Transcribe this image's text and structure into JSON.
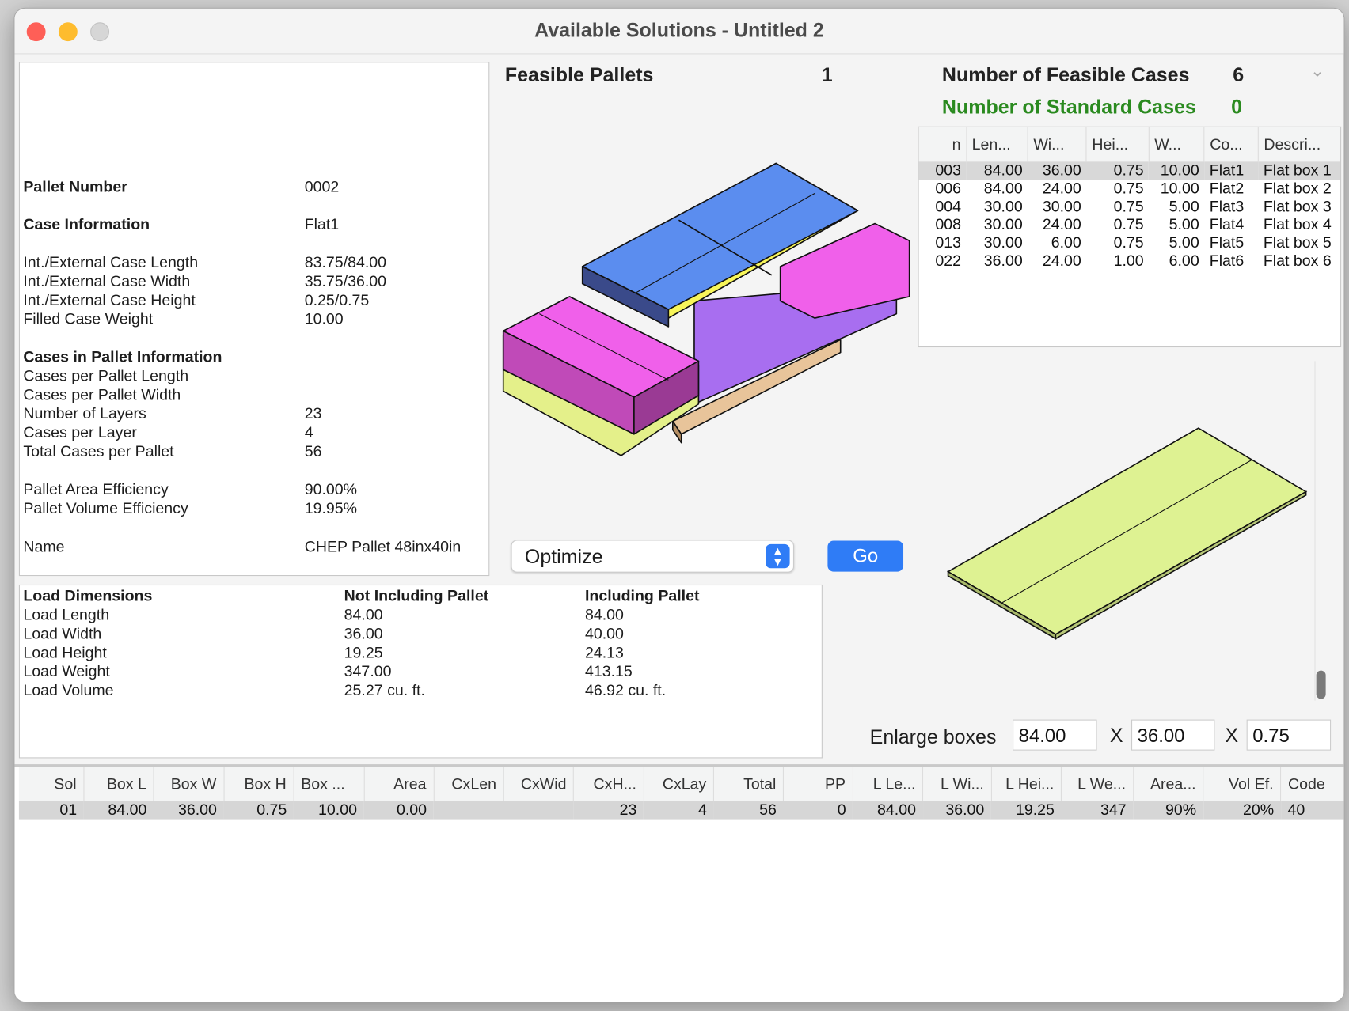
{
  "window": {
    "title": "Available Solutions - Untitled 2"
  },
  "info": {
    "rows": [
      {
        "label": "Pallet Number",
        "value": "0002",
        "bold": true
      },
      {
        "label": "Case Information",
        "value": "Flat1",
        "bold": true
      },
      {
        "label": "Int./External Case Length",
        "value": "83.75/84.00"
      },
      {
        "label": "Int./External Case Width",
        "value": "35.75/36.00"
      },
      {
        "label": "Int./External Case Height",
        "value": "0.25/0.75"
      },
      {
        "label": "Filled Case Weight",
        "value": "10.00"
      },
      {
        "label": "Cases in Pallet Information",
        "value": "",
        "bold": true
      },
      {
        "label": "Cases per Pallet Length",
        "value": ""
      },
      {
        "label": "Cases per Pallet Width",
        "value": ""
      },
      {
        "label": "Number of Layers",
        "value": "23"
      },
      {
        "label": "Cases per Layer",
        "value": "4"
      },
      {
        "label": "Total Cases per Pallet",
        "value": "56"
      },
      {
        "label": "Pallet Area Efficiency",
        "value": "90.00%"
      },
      {
        "label": "Pallet Volume Efficiency",
        "value": "19.95%"
      },
      {
        "label": "Name",
        "value": "CHEP Pallet 48inx40in"
      }
    ]
  },
  "summary": {
    "feasible_pallets_label": "Feasible Pallets",
    "feasible_pallets": "1",
    "feasible_cases_label": "Number of Feasible Cases",
    "feasible_cases": "6",
    "standard_cases_label": "Number of Standard Cases",
    "standard_cases": "0"
  },
  "cases_table": {
    "headers": [
      "n",
      "Len...",
      "Wi...",
      "Hei...",
      "W...",
      "Co...",
      "Descri..."
    ],
    "rows": [
      [
        "003",
        "84.00",
        "36.00",
        "0.75",
        "10.00",
        "Flat1",
        "Flat box 1"
      ],
      [
        "006",
        "84.00",
        "24.00",
        "0.75",
        "10.00",
        "Flat2",
        "Flat box 2"
      ],
      [
        "004",
        "30.00",
        "30.00",
        "0.75",
        "5.00",
        "Flat3",
        "Flat box 3"
      ],
      [
        "008",
        "30.00",
        "24.00",
        "0.75",
        "5.00",
        "Flat4",
        "Flat box 4"
      ],
      [
        "013",
        "30.00",
        "6.00",
        "0.75",
        "5.00",
        "Flat5",
        "Flat box 5"
      ],
      [
        "022",
        "36.00",
        "24.00",
        "1.00",
        "6.00",
        "Flat6",
        "Flat box 6"
      ]
    ]
  },
  "controls": {
    "mode_select": "Optimize",
    "go_label": "Go",
    "enlarge_label": "Enlarge boxes",
    "x_label": "X",
    "enlarge_l": "84.00",
    "enlarge_w": "36.00",
    "enlarge_h": "0.75"
  },
  "load": {
    "headers": [
      "Load Dimensions",
      "Not Including Pallet",
      "Including Pallet"
    ],
    "rows": [
      [
        "Load Length",
        "84.00",
        "84.00"
      ],
      [
        "Load Width",
        "36.00",
        "40.00"
      ],
      [
        "Load Height",
        "19.25",
        "24.13"
      ],
      [
        "Load Weight",
        "347.00",
        "413.15"
      ],
      [
        "Load Volume",
        "25.27 cu. ft.",
        "46.92 cu. ft."
      ]
    ]
  },
  "solutions": {
    "headers": [
      "Sol",
      "Box L",
      "Box W",
      "Box H",
      "Box ...",
      "Area",
      "CxLen",
      "CxWid",
      "CxH...",
      "CxLay",
      "Total",
      "PP",
      "L Le...",
      "L Wi...",
      "L Hei...",
      "L We...",
      "Area...",
      "Vol Ef.",
      "Code"
    ],
    "rows": [
      [
        "01",
        "84.00",
        "36.00",
        "0.75",
        "10.00",
        "0.00",
        "",
        "",
        "23",
        "4",
        "56",
        "0",
        "84.00",
        "36.00",
        "19.25",
        "347",
        "90%",
        "20%",
        "40"
      ]
    ]
  },
  "colors": {
    "blue": "#5b8def",
    "yellow": "#f8f65a",
    "magenta": "#f060ea",
    "purple": "#a86ef0",
    "lime": "#def292",
    "wood": "#e8c49a",
    "go": "#2f7cf6",
    "standard": "#2a8a1f"
  }
}
